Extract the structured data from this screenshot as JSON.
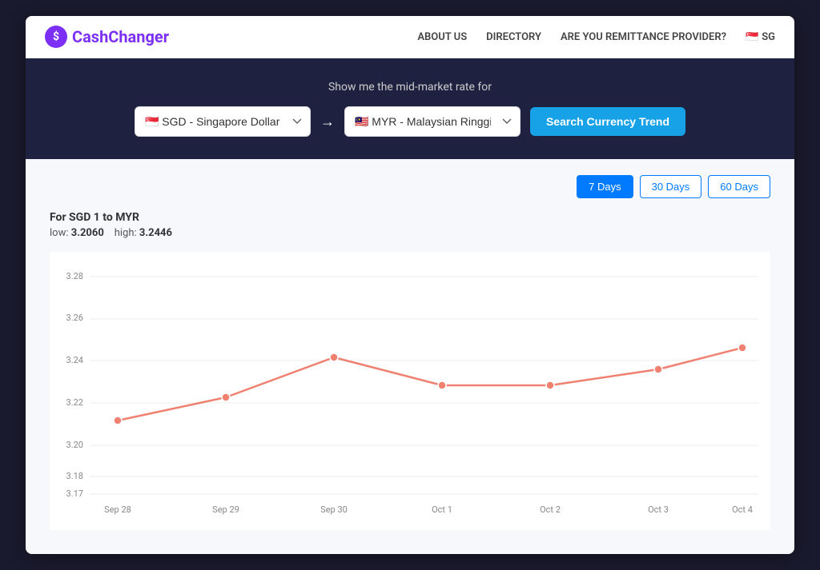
{
  "header": {
    "logo_text": "CashChanger",
    "nav": {
      "about": "ABOUT US",
      "directory": "DIRECTORY",
      "remittance": "ARE YOU REMITTANCE PROVIDER?",
      "country": "SG"
    }
  },
  "hero": {
    "label": "Show me the mid-market rate for",
    "from_currency": "SGD - Singapore Dollar",
    "to_currency": "MYR - Malaysian Ringgit",
    "search_btn": "Search Currency Trend",
    "arrow": "→"
  },
  "chart": {
    "day_buttons": [
      "7 Days",
      "30 Days",
      "60 Days"
    ],
    "active_day": 0,
    "title": "For SGD 1 to MYR",
    "low_label": "low:",
    "low_value": "3.2060",
    "high_label": "high:",
    "high_value": "3.2446",
    "y_labels": [
      "3.28",
      "3.26",
      "3.24",
      "3.22",
      "3.20",
      "3.18",
      "3.17"
    ],
    "x_labels": [
      "Sep 28",
      "Sep 29",
      "Sep 30",
      "Oct 1",
      "Oct 2",
      "Oct 3",
      "Oct 4"
    ],
    "data_points": [
      {
        "x": 0,
        "y": 3.207
      },
      {
        "x": 1,
        "y": 3.219
      },
      {
        "x": 2,
        "y": 3.239
      },
      {
        "x": 3,
        "y": 3.225
      },
      {
        "x": 4,
        "y": 3.225
      },
      {
        "x": 5,
        "y": 3.233
      },
      {
        "x": 6,
        "y": 3.244
      }
    ]
  }
}
